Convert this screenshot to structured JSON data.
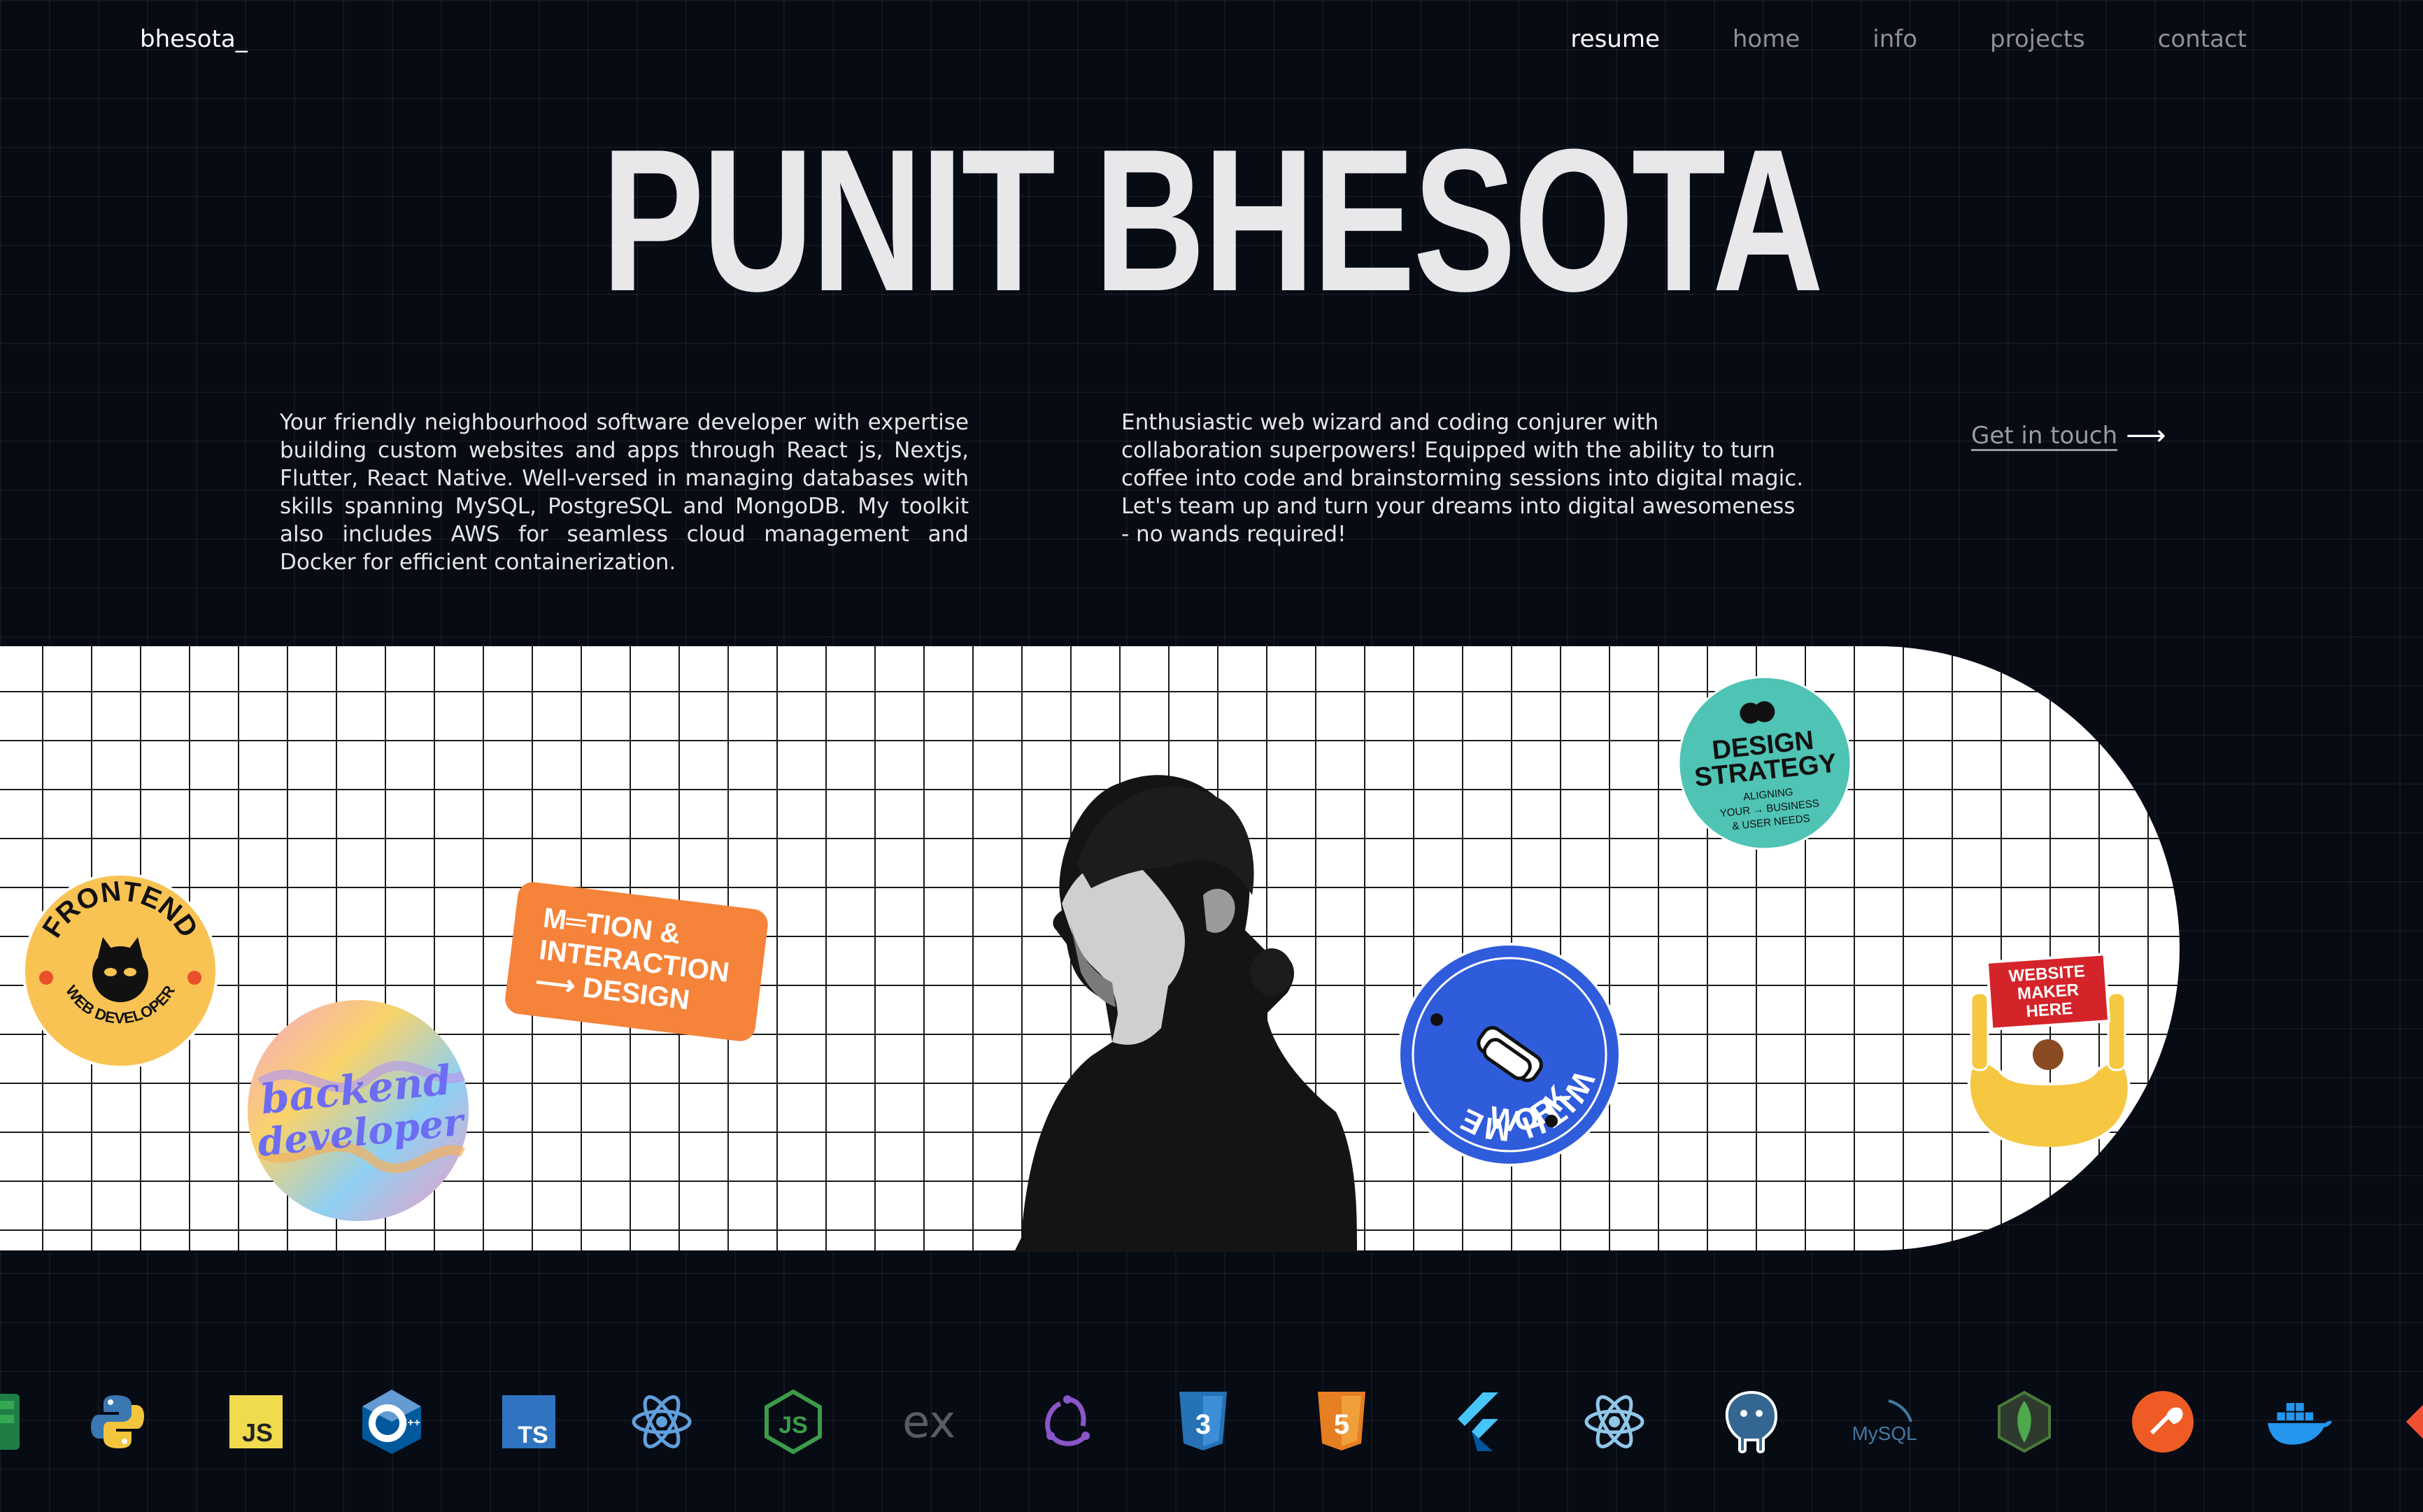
{
  "header": {
    "logo": "bhesota_",
    "nav": [
      {
        "label": "resume",
        "active": true
      },
      {
        "label": "home"
      },
      {
        "label": "info"
      },
      {
        "label": "projects"
      },
      {
        "label": "contact"
      }
    ]
  },
  "hero": {
    "title": "PUNIT BHESOTA",
    "intro": "Your friendly neighbourhood software developer with expertise building custom websites and apps through React js, Nextjs, Flutter, React Native. Well-versed in managing databases with skills spanning MySQL, PostgreSQL and MongoDB. My toolkit also includes AWS for seamless cloud management and Docker for efficient containerization.",
    "tagline": "Enthusiastic web wizard and coding conjurer with collaboration superpowers! Equipped with the ability to turn coffee into code and brainstorming sessions into digital magic. Let's team up and turn your dreams into digital awesomeness - no wands required!",
    "cta_label": "Get in touch",
    "cta_arrow": "⟶"
  },
  "stickers": {
    "frontend": {
      "top": "FRONTEND",
      "bottom": "WEB DEVELOPER"
    },
    "backend": {
      "text1": "backend",
      "text2": "developer"
    },
    "motion": {
      "line1": "M═TION &",
      "line2": "INTERACTION",
      "line3": "⟶ DESIGN"
    },
    "design": {
      "line1": "DESIGN",
      "line2": "STRATEGY",
      "line3": "ALIGNING",
      "line4": "YOUR → BUSINESS",
      "line5": "& USER NEEDS"
    },
    "work": {
      "top": "WITH ME",
      "bottom": "WORK"
    },
    "maker": {
      "line1": "WEBSITE",
      "line2": "MAKER",
      "line3": "HERE"
    }
  },
  "tech_labels": {
    "js": "JS",
    "ts": "TS",
    "cpp": "C++",
    "express": "ex",
    "mysql": "MySQL"
  },
  "colors": {
    "background": "#070b14",
    "frontend_yellow": "#f9c354",
    "motion_orange": "#f5833a",
    "design_teal": "#4fc3b4",
    "work_blue": "#2f5cdb",
    "maker_red": "#d4242a"
  },
  "tech_icons": [
    "excel-icon",
    "python-icon",
    "javascript-icon",
    "cplusplus-icon",
    "typescript-icon",
    "react-icon",
    "nodejs-icon",
    "express-icon",
    "redux-icon",
    "css3-icon",
    "html5-icon",
    "flutter-icon",
    "react-native-icon",
    "postgresql-icon",
    "mysql-icon",
    "mongodb-icon",
    "postman-icon",
    "docker-icon",
    "git-icon"
  ]
}
